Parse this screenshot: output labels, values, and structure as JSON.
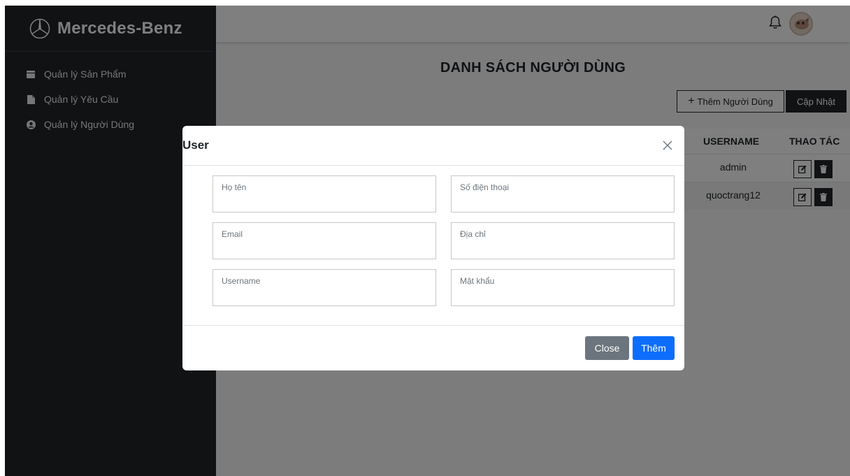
{
  "sidebar": {
    "brand": "Mercedes-Benz",
    "brand_icon": "mercedes-star-logo",
    "items": [
      {
        "label": "Quản lý Sản Phẩm",
        "icon": "calendar-icon"
      },
      {
        "label": "Quản lý Yêu Cầu",
        "icon": "file-icon"
      },
      {
        "label": "Quản lý Người Dùng",
        "icon": "user-circle-icon"
      }
    ]
  },
  "topbar": {
    "bell_icon": "bell-icon",
    "avatar": "user-avatar"
  },
  "page": {
    "title": "DANH SÁCH NGƯỜI DÙNG",
    "add_button": "Thêm Người Dùng",
    "add_icon": "+",
    "update_button": "Cập Nhật"
  },
  "table": {
    "headers": {
      "username": "USERNAME",
      "action": "THAO TÁC"
    },
    "rows": [
      {
        "username": "admin"
      },
      {
        "username": "quoctrang12"
      }
    ]
  },
  "modal": {
    "title": "User",
    "fields": {
      "fullname": {
        "placeholder": "Họ tên"
      },
      "phone": {
        "placeholder": "Số điện thoại"
      },
      "email": {
        "placeholder": "Email"
      },
      "address": {
        "placeholder": "Địa chỉ"
      },
      "username": {
        "placeholder": "Username"
      },
      "password": {
        "placeholder": "Mật khẩu"
      }
    },
    "close_button": "Close",
    "submit_button": "Thêm"
  },
  "colors": {
    "sidebar_bg": "#212529",
    "primary": "#0d6efd",
    "secondary": "#6c757d"
  }
}
